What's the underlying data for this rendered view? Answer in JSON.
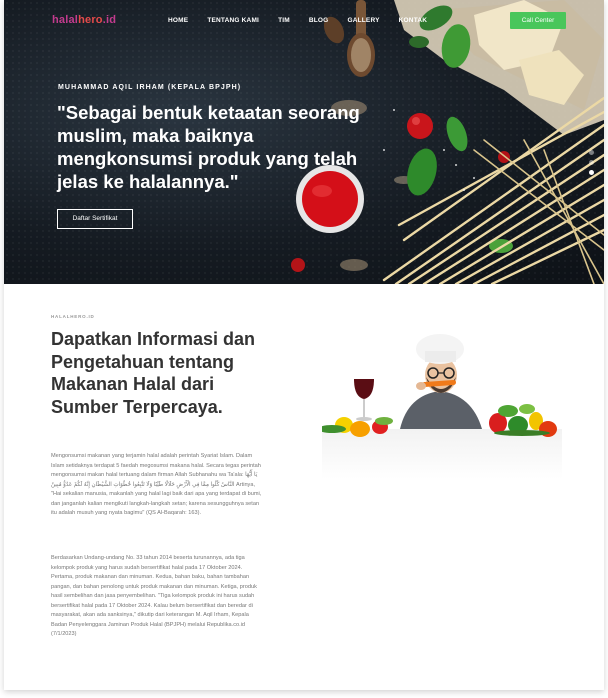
{
  "brand": {
    "part1": "halal",
    "part2": "hero",
    "part3": ".id"
  },
  "nav": {
    "items": [
      "HOME",
      "TENTANG KAMI",
      "TIM",
      "BLOG",
      "GALLERY",
      "KONTAK"
    ],
    "call_button": "Call Center"
  },
  "hero": {
    "caption": "MUHAMMAD AQIL IRHAM (KEPALA BPJPH)",
    "quote": "\"Sebagai bentuk ketaatan seorang muslim, maka baiknya mengkonsumsi produk yang telah jelas ke halalannya.\"",
    "button": "Daftar Sertifikat",
    "slides": 3,
    "active_slide": 3
  },
  "about": {
    "eyebrow": "HALALHERO.ID",
    "heading": "Dapatkan Informasi dan Pengetahuan tentang Makanan Halal dari Sumber Terpercaya.",
    "paragraph1": "Mengonsumsi makanan yang terjamin halal adalah perintah Syariat Islam. Dalam Islam setidaknya terdapat 5 faedah megosumsi makana halal. Secara tegas perintah mengonsumsi makan halal tertuang dalam firman Allah Subhanahu wa Ta'ala: يَا أَيُّهَا النَّاسُ كُلُوا مِمَّا فِي الْأَرْضِ حَلَالًا طَيِّبًا وَلَا تَتَّبِعُوا خُطُوَاتِ الشَّيْطَانِ إِنَّهُ لَكُمْ عَدُوٌّ مُبِينٌ Artinya, \"Hai sekalian manusia, makanlah yang halal lagi baik dari apa yang terdapat di bumi, dan janganlah kalian mengikuti langkah-langkah setan; karena sesungguhnya setan itu adalah musuh yang nyata bagimu\" (QS Al-Baqarah: 163).",
    "paragraph2": "Berdasarkan Undang-undang No. 33 tahun 2014 beserta turunannya, ada tiga kelompok produk yang harus sudah bersertifikat halal pada 17 Oktober 2024. Pertama, produk makanan dan minuman. Kedua, bahan baku, bahan tambahan pangan, dan bahan penolong untuk produk makanan dan minuman. Ketiga, produk hasil sembelihan dan jasa penyembelihan. \"Tiga kelompok produk ini harus sudah bersertifikat halal pada 17 Oktober 2024. Kalau belum bersertifikat dan beredar di masyarakat, akan ada sanksinya,\" dikutip dari keterangan M. Aqil Irham, Kepala Badan Penyelenggara Jaminan Produk Halal (BPJPH) melalui Republika.co.id (7/1/2023)"
  },
  "colors": {
    "accent_green": "#49c65b",
    "brand_magenta": "#c33b8e",
    "brand_red": "#e54a4a"
  }
}
